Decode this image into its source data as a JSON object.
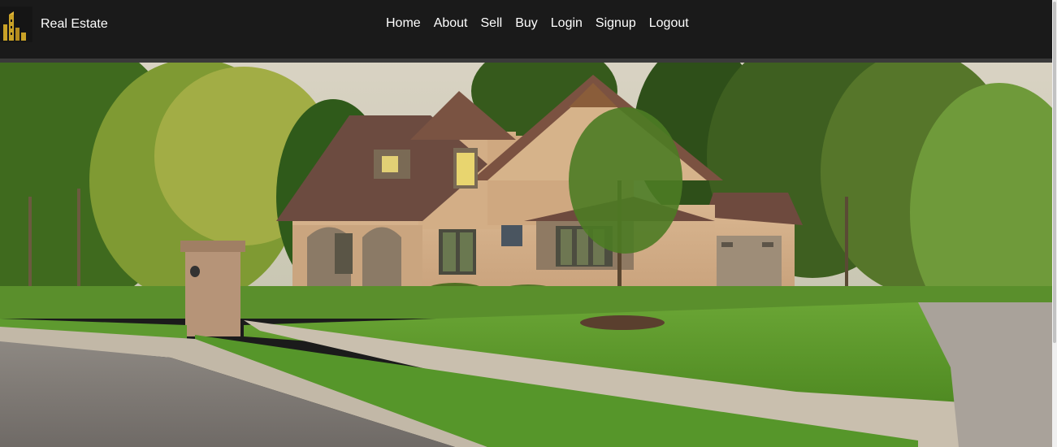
{
  "brand": {
    "name": "Real Estate",
    "logo_icon": "building-logo-icon",
    "logo_color": "#c9a227"
  },
  "nav": {
    "items": [
      {
        "label": "Home"
      },
      {
        "label": "About"
      },
      {
        "label": "Sell"
      },
      {
        "label": "Buy"
      },
      {
        "label": "Login"
      },
      {
        "label": "Signup"
      },
      {
        "label": "Logout"
      }
    ]
  },
  "hero": {
    "image_icon": "house-photo",
    "sky_color": "#dcd6c6",
    "lawn_color": "#5f9e2c"
  },
  "colors": {
    "navbar_bg": "#1a1a1a",
    "nav_text": "#ffffff"
  }
}
